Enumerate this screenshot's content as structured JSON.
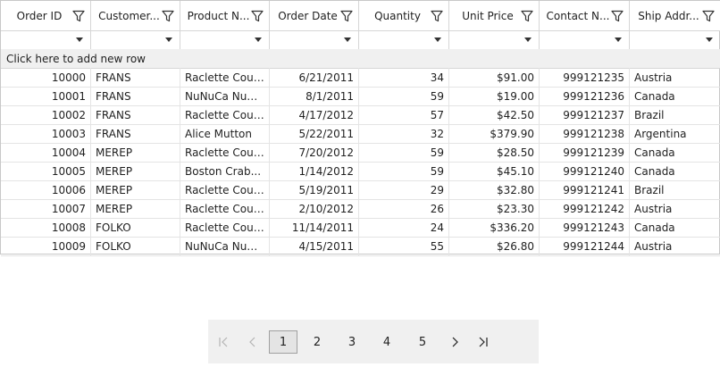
{
  "columns": [
    {
      "label": "Order ID",
      "width": 101
    },
    {
      "label": "Customer...",
      "width": 100
    },
    {
      "label": "Product N...",
      "width": 100
    },
    {
      "label": "Order Date",
      "width": 100
    },
    {
      "label": "Quantity",
      "width": 101
    },
    {
      "label": "Unit Price",
      "width": 101
    },
    {
      "label": "Contact N...",
      "width": 101
    },
    {
      "label": "Ship Addr...",
      "width": 102
    }
  ],
  "add_row_text": "Click here to add new row",
  "rows": [
    [
      "10000",
      "FRANS",
      "Raclette Courd...",
      "6/21/2011",
      "34",
      "$91.00",
      "999121235",
      "Austria"
    ],
    [
      "10001",
      "FRANS",
      "NuNuCa Nuß-...",
      "8/1/2011",
      "59",
      "$19.00",
      "999121236",
      "Canada"
    ],
    [
      "10002",
      "FRANS",
      "Raclette Courd...",
      "4/17/2012",
      "57",
      "$42.50",
      "999121237",
      "Brazil"
    ],
    [
      "10003",
      "FRANS",
      "Alice Mutton",
      "5/22/2011",
      "32",
      "$379.90",
      "999121238",
      "Argentina"
    ],
    [
      "10004",
      "MEREP",
      "Raclette Courd...",
      "7/20/2012",
      "59",
      "$28.50",
      "999121239",
      "Canada"
    ],
    [
      "10005",
      "MEREP",
      "Boston Crab...",
      "1/14/2012",
      "59",
      "$45.10",
      "999121240",
      "Canada"
    ],
    [
      "10006",
      "MEREP",
      "Raclette Courd...",
      "5/19/2011",
      "29",
      "$32.80",
      "999121241",
      "Brazil"
    ],
    [
      "10007",
      "MEREP",
      "Raclette Courd...",
      "2/10/2012",
      "26",
      "$23.30",
      "999121242",
      "Austria"
    ],
    [
      "10008",
      "FOLKO",
      "Raclette Courd...",
      "11/14/2011",
      "24",
      "$336.20",
      "999121243",
      "Canada"
    ],
    [
      "10009",
      "FOLKO",
      "NuNuCa Nuß-...",
      "4/15/2011",
      "55",
      "$26.80",
      "999121244",
      "Austria"
    ]
  ],
  "pager": {
    "first_icon": "first-page-icon",
    "prev_icon": "prev-page-icon",
    "pages": [
      "1",
      "2",
      "3",
      "4",
      "5"
    ],
    "active_page": "1",
    "next_icon": "next-page-icon",
    "last_icon": "last-page-icon"
  }
}
